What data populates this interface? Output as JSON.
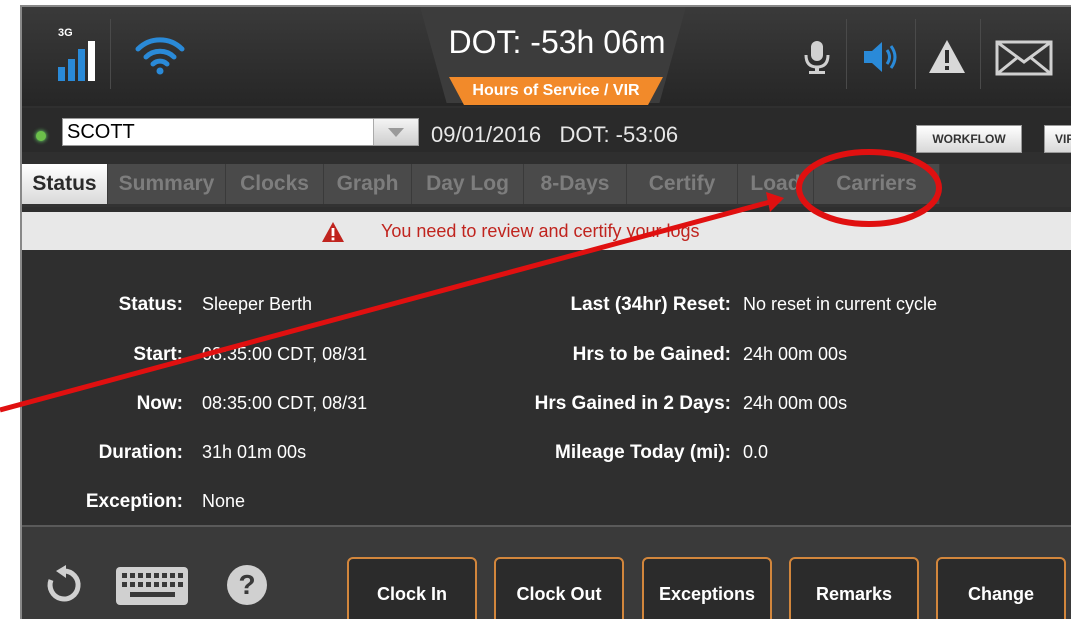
{
  "header": {
    "network_label": "3G",
    "title": "DOT: -53h 06m",
    "mode_badge": "Hours of Service / VIR",
    "icons": [
      "signal-icon",
      "wifi-icon",
      "microphone-icon",
      "speaker-icon",
      "warning-icon",
      "mail-icon"
    ],
    "accent_color": "#f28a2a",
    "active_icon_color": "#2a8ad8"
  },
  "driver_bar": {
    "driver": "SCOTT",
    "date": "09/01/2016",
    "dot_clock": "DOT: -53:06",
    "workflow_label": "WORKFLOW",
    "vir_label": "VIR"
  },
  "tabs": [
    {
      "label": "Status"
    },
    {
      "label": "Summary"
    },
    {
      "label": "Clocks"
    },
    {
      "label": "Graph"
    },
    {
      "label": "Day Log"
    },
    {
      "label": "8-Days"
    },
    {
      "label": "Certify"
    },
    {
      "label": "Load"
    },
    {
      "label": "Carriers"
    }
  ],
  "alert": {
    "text": "You need to review and certify your logs",
    "color": "#c0241e"
  },
  "status_left": [
    {
      "label": "Status:",
      "value": "Sleeper Berth"
    },
    {
      "label": "Start:",
      "value": "08:35:00 CDT, 08/31"
    },
    {
      "label": "Now:",
      "value": "08:35:00 CDT, 08/31"
    },
    {
      "label": "Duration:",
      "value": "31h 01m 00s"
    },
    {
      "label": "Exception:",
      "value": "None"
    }
  ],
  "status_right": [
    {
      "label": "Last (34hr) Reset:",
      "value": "No reset in current cycle"
    },
    {
      "label": "Hrs to be Gained:",
      "value": "24h 00m 00s"
    },
    {
      "label": "Hrs Gained in 2 Days:",
      "value": "24h 00m 00s"
    },
    {
      "label": "Mileage Today (mi):",
      "value": "0.0"
    }
  ],
  "actions": {
    "icons": [
      "refresh-icon",
      "keyboard-icon",
      "help-icon"
    ],
    "help_glyph": "?",
    "buttons": [
      {
        "label": "Clock In"
      },
      {
        "label": "Clock Out"
      },
      {
        "label": "Exceptions"
      },
      {
        "label": "Remarks"
      },
      {
        "label": "Change"
      }
    ],
    "button_border_color": "#d2863c"
  },
  "annotation": {
    "highlight_color": "#e01010"
  }
}
